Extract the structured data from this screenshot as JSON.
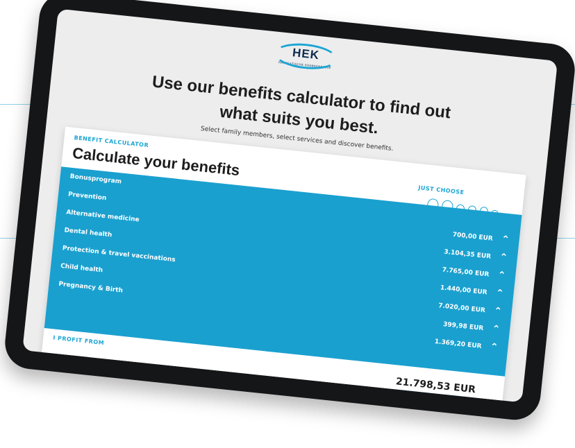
{
  "header": {
    "logo": "HEK",
    "logo_subtitle": "HANSEATISCHE KRANKENKASSE",
    "headline_line1": "Use our benefits calculator to find out",
    "headline_line2": "what suits you best.",
    "lead": "Select family members, select services and discover benefits."
  },
  "calculator": {
    "eyebrow": "BENEFIT CALCULATOR",
    "title": "Calculate your benefits",
    "just_choose": "JUST CHOOSE",
    "avatar_icons": [
      "woman-icon",
      "man-icon",
      "girl-icon",
      "boy-icon",
      "child-icon",
      "baby-icon"
    ],
    "rows": [
      {
        "label": "Bonusprogram",
        "amount": ""
      },
      {
        "label": "Prevention",
        "amount": "700,00 EUR"
      },
      {
        "label": "Alternative medicine",
        "amount": "3.104,35 EUR"
      },
      {
        "label": "Dental health",
        "amount": "7.765,00 EUR"
      },
      {
        "label": "Protection & travel vaccinations",
        "amount": "1.440,00 EUR"
      },
      {
        "label": "Child health",
        "amount": "7.020,00 EUR"
      },
      {
        "label": "Pregnancy & Birth",
        "amount": "399,98 EUR"
      },
      {
        "label": "",
        "amount": "1.369,20 EUR"
      }
    ],
    "profit_label": "I PROFIT FROM",
    "total": "21.798,53 EUR",
    "accent": "#1aa0cf"
  }
}
